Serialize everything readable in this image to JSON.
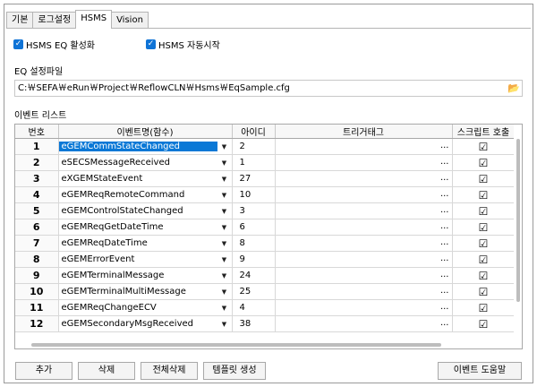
{
  "tabs": [
    "기본",
    "로그설정",
    "HSMS",
    "Vision"
  ],
  "active_tab": "HSMS",
  "options": {
    "hsms_eq_enable": {
      "label": "HSMS EQ 활성화",
      "checked": true
    },
    "hsms_auto_start": {
      "label": "HSMS 자동시작",
      "checked": true
    }
  },
  "eq_config": {
    "label": "EQ 설정파일",
    "path": "C:￦SEFA￦eRun￦Project￦ReflowCLN￦Hsms￦EqSample.cfg"
  },
  "event_list": {
    "label": "이벤트 리스트",
    "columns": [
      "번호",
      "이벤트명(함수)",
      "아이디",
      "트리거태그",
      "스크립트 호출"
    ],
    "selected_row": 1,
    "rows": [
      {
        "no": "1",
        "event": "eGEMCommStateChanged",
        "id": "2",
        "trigger": "",
        "script": true
      },
      {
        "no": "2",
        "event": "eSECSMessageReceived",
        "id": "1",
        "trigger": "",
        "script": true
      },
      {
        "no": "3",
        "event": "eXGEMStateEvent",
        "id": "27",
        "trigger": "",
        "script": true
      },
      {
        "no": "4",
        "event": "eGEMReqRemoteCommand",
        "id": "10",
        "trigger": "",
        "script": true
      },
      {
        "no": "5",
        "event": "eGEMControlStateChanged",
        "id": "3",
        "trigger": "",
        "script": true
      },
      {
        "no": "6",
        "event": "eGEMReqGetDateTime",
        "id": "6",
        "trigger": "",
        "script": true
      },
      {
        "no": "7",
        "event": "eGEMReqDateTime",
        "id": "8",
        "trigger": "",
        "script": true
      },
      {
        "no": "8",
        "event": "eGEMErrorEvent",
        "id": "9",
        "trigger": "",
        "script": true
      },
      {
        "no": "9",
        "event": "eGEMTerminalMessage",
        "id": "24",
        "trigger": "",
        "script": true
      },
      {
        "no": "10",
        "event": "eGEMTerminalMultiMessage",
        "id": "25",
        "trigger": "",
        "script": true
      },
      {
        "no": "11",
        "event": "eGEMReqChangeECV",
        "id": "4",
        "trigger": "",
        "script": true
      },
      {
        "no": "12",
        "event": "eGEMSecondaryMsgReceived",
        "id": "38",
        "trigger": "",
        "script": true
      }
    ]
  },
  "buttons": {
    "add": "추가",
    "delete": "삭제",
    "delete_all": "전체삭제",
    "create_template": "템플릿 생성",
    "event_help": "이벤트 도움말"
  },
  "colors": {
    "checkbox": "#0f73d6",
    "selection": "#0a78d6"
  }
}
